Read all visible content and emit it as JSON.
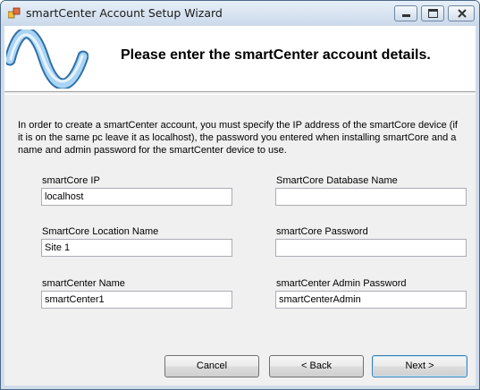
{
  "window": {
    "title": "smartCenter Account Setup Wizard"
  },
  "header": {
    "heading": "Please enter the smartCenter account details."
  },
  "intro": "In order to create a smartCenter account, you must specify the IP address of the smartCore device (if it is on the same pc leave it as localhost), the password you entered when installing smartCore  and a name and admin password for the smartCenter device to use.",
  "form": {
    "smartcore_ip": {
      "label": "smartCore IP",
      "value": "localhost"
    },
    "smartcore_db_name": {
      "label": "SmartCore Database Name",
      "value": ""
    },
    "smartcore_location": {
      "label": "SmartCore Location Name",
      "value": "Site 1"
    },
    "smartcore_password": {
      "label": "smartCore Password",
      "value": ""
    },
    "smartcenter_name": {
      "label": "smartCenter Name",
      "value": "smartCenter1"
    },
    "smartcenter_admin_password": {
      "label": "smartCenter Admin Password",
      "value": "smartCenterAdmin"
    }
  },
  "buttons": {
    "cancel": "Cancel",
    "back": "< Back",
    "next": "Next >"
  },
  "colors": {
    "accent": "#3c7fb1",
    "logo_wave": "#8ec3ef",
    "title_bar": "#cad9ea"
  }
}
